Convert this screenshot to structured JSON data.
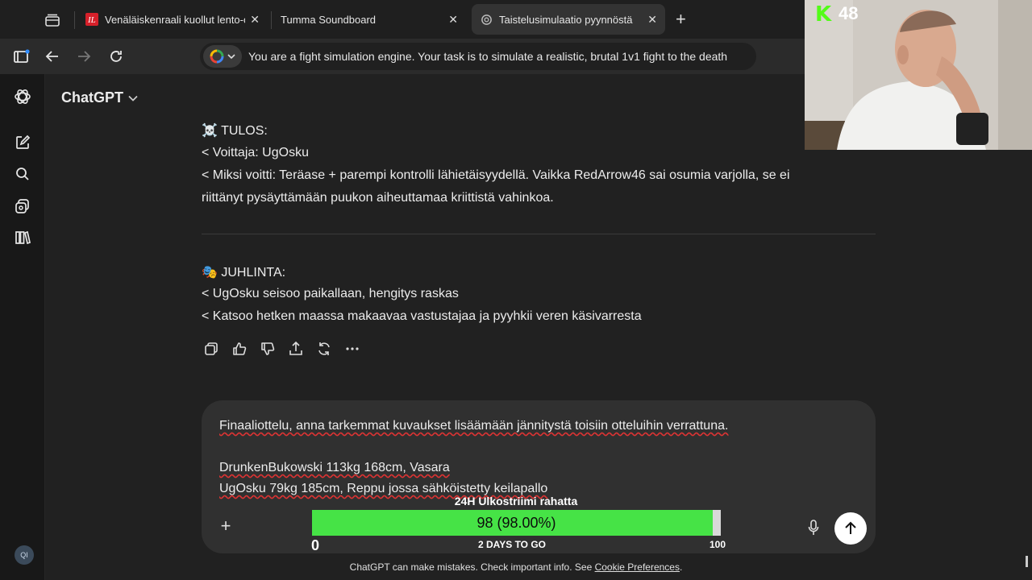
{
  "browser": {
    "tabs": [
      {
        "title": "Venäläiskenraali kuollut lento-o",
        "close": "✕",
        "active": false
      },
      {
        "title": "Tumma Soundboard",
        "close": "✕",
        "active": false
      },
      {
        "title": "Taistelusimulaatio pyynnöstä",
        "close": "✕",
        "active": true
      }
    ],
    "new_tab": "+",
    "address": "You are a fight simulation engine.  Your task is to simulate a realistic, brutal 1v1 fight to the death"
  },
  "app": {
    "name": "ChatGPT",
    "avatar_initials": "QI"
  },
  "message": {
    "result_heading": "☠️ TULOS:",
    "winner_line": "< Voittaja: UgOsku",
    "reason_line1": "< Miksi voitti: Teräase + parempi kontrolli lähietäisyydellä. Vaikka RedArrow46 sai osumia varjolla, se ei",
    "reason_line2": "riittänyt pysäyttämään puukon aiheuttamaa kriittistä vahinkoa.",
    "celebration_heading": "🎭 JUHLINTA:",
    "celebration_line1": "< UgOsku seisoo paikallaan, hengitys raskas",
    "celebration_line2": "< Katsoo hetken maassa makaavaa vastustajaa ja pyyhkii veren käsivarresta"
  },
  "composer": {
    "line1": "Finaaliottelu, anna tarkemmat kuvaukset lisäämään jännitystä toisiin otteluihin verrattuna.",
    "line2": "DrunkenBukowski 113kg 168cm, Vasara",
    "line3": "UgOsku 79kg 185cm, Reppu jossa sähköistetty keilapallo"
  },
  "goal_overlay": {
    "title": "24H Ulkostriimi rahatta",
    "label": "98 (98.00%)",
    "progress_fraction": 0.98,
    "min": "0",
    "middle": "2 DAYS TO GO",
    "max": "100",
    "fill_color": "#46e346"
  },
  "footer": {
    "text": "ChatGPT can make mistakes. Check important info. See ",
    "link": "Cookie Preferences",
    "end": "."
  },
  "webcam": {
    "logo": "K",
    "count": "48"
  }
}
